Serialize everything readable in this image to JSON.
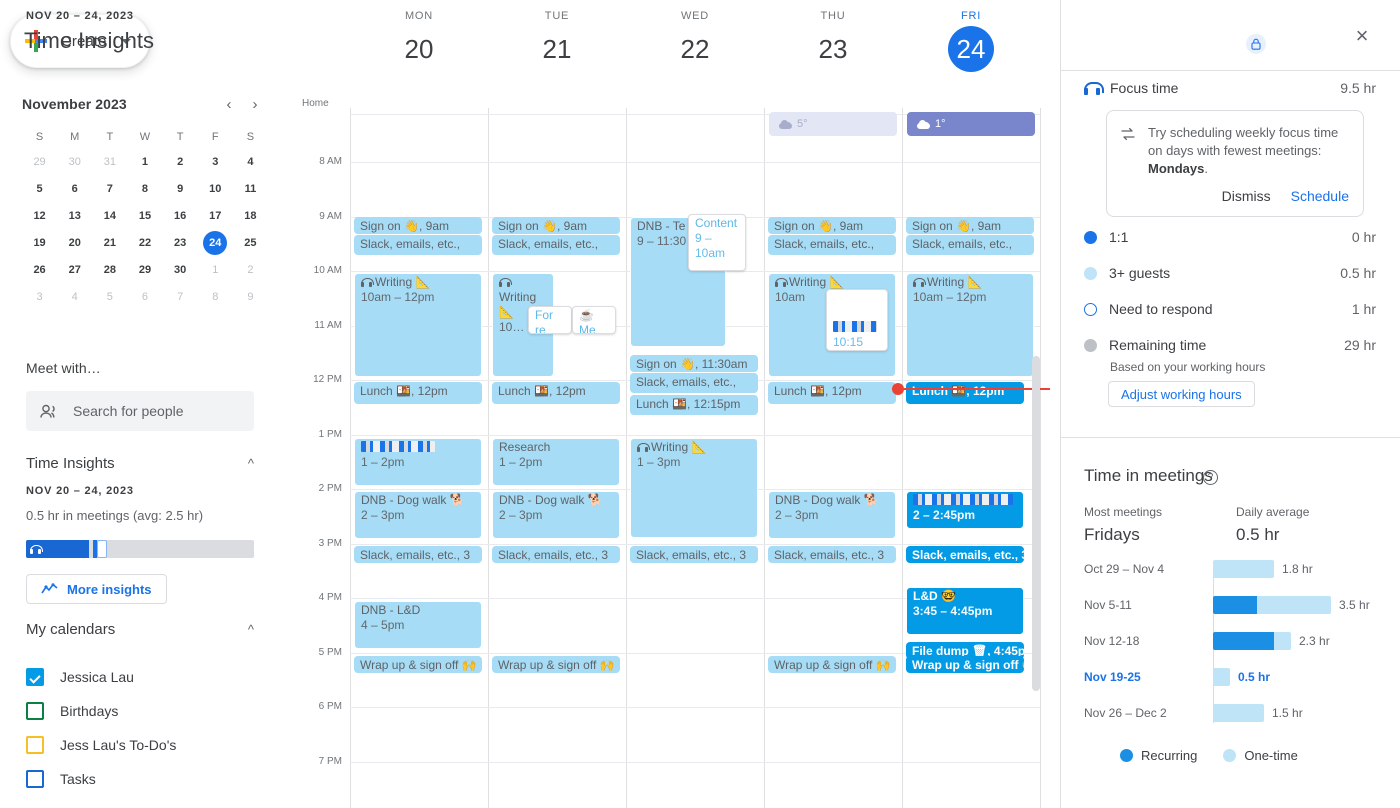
{
  "sidebar": {
    "create": {
      "label": "Create",
      "icon": "plus-icon",
      "caret": "chevron-down-icon"
    },
    "mini_calendar": {
      "title": "November 2023",
      "prev": "‹",
      "next": "›",
      "weekday_initials": [
        "S",
        "M",
        "T",
        "W",
        "T",
        "F",
        "S"
      ],
      "weeks": [
        [
          {
            "d": "29",
            "dim": true
          },
          {
            "d": "30",
            "dim": true
          },
          {
            "d": "31",
            "dim": true
          },
          {
            "d": "1"
          },
          {
            "d": "2"
          },
          {
            "d": "3"
          },
          {
            "d": "4"
          }
        ],
        [
          {
            "d": "5"
          },
          {
            "d": "6"
          },
          {
            "d": "7"
          },
          {
            "d": "8"
          },
          {
            "d": "9"
          },
          {
            "d": "10"
          },
          {
            "d": "11"
          }
        ],
        [
          {
            "d": "12"
          },
          {
            "d": "13"
          },
          {
            "d": "14"
          },
          {
            "d": "15"
          },
          {
            "d": "16"
          },
          {
            "d": "17"
          },
          {
            "d": "18"
          }
        ],
        [
          {
            "d": "19"
          },
          {
            "d": "20"
          },
          {
            "d": "21"
          },
          {
            "d": "22"
          },
          {
            "d": "23"
          },
          {
            "d": "24",
            "today": true
          },
          {
            "d": "25"
          }
        ],
        [
          {
            "d": "26"
          },
          {
            "d": "27"
          },
          {
            "d": "28"
          },
          {
            "d": "29"
          },
          {
            "d": "30"
          },
          {
            "d": "1",
            "dim": true
          },
          {
            "d": "2",
            "dim": true
          }
        ],
        [
          {
            "d": "3",
            "dim": true
          },
          {
            "d": "4",
            "dim": true
          },
          {
            "d": "5",
            "dim": true
          },
          {
            "d": "6",
            "dim": true
          },
          {
            "d": "7",
            "dim": true
          },
          {
            "d": "8",
            "dim": true
          },
          {
            "d": "9",
            "dim": true
          }
        ]
      ]
    },
    "meet_with": {
      "title": "Meet with…",
      "search_placeholder": "Search for people"
    },
    "time_insights": {
      "title": "Time Insights",
      "range": "NOV 20 – 24, 2023",
      "meetings_line": "0.5 hr in meetings (avg: 2.5 hr)",
      "more_insights_label": "More insights"
    },
    "my_calendars": {
      "title": "My calendars",
      "items": [
        {
          "label": "Jessica Lau",
          "color": "#039be5",
          "checked": true
        },
        {
          "label": "Birthdays",
          "color": "#0b8043",
          "checked": false
        },
        {
          "label": "Jess Lau's To-Do's",
          "color": "#f6bf26",
          "checked": false
        },
        {
          "label": "Tasks",
          "color": "#1967d2",
          "checked": false
        }
      ]
    }
  },
  "calendar": {
    "timezone_label": "Home",
    "days": [
      {
        "dow": "MON",
        "num": "20",
        "today": false
      },
      {
        "dow": "TUE",
        "num": "21",
        "today": false
      },
      {
        "dow": "WED",
        "num": "22",
        "today": false
      },
      {
        "dow": "THU",
        "num": "23",
        "today": false
      },
      {
        "dow": "FRI",
        "num": "24",
        "today": true
      }
    ],
    "hour_labels": [
      "8 AM",
      "9 AM",
      "10 AM",
      "11 AM",
      "12 PM",
      "1 PM",
      "2 PM",
      "3 PM",
      "4 PM",
      "5 PM",
      "6 PM",
      "7 PM"
    ],
    "weather": [
      {
        "day": 3,
        "temp": "5°",
        "style": "muted"
      },
      {
        "day": 4,
        "temp": "1°",
        "style": "solid"
      }
    ],
    "events": {
      "mon": [
        {
          "title": "Sign on 👋, 9am",
          "kind": "chip"
        },
        {
          "title": "Slack, emails, etc.,",
          "kind": "chip"
        },
        {
          "title": "Writing 📐",
          "time": "10am – 12pm",
          "kind": "block",
          "focus": true
        },
        {
          "title": "Lunch 🍱, 12pm",
          "kind": "chip"
        },
        {
          "title": "",
          "time": "1 – 2pm",
          "kind": "block",
          "redacted": true
        },
        {
          "title": "DNB - Dog walk 🐕",
          "time": "2 – 3pm",
          "kind": "block"
        },
        {
          "title": "Slack, emails, etc., 3",
          "kind": "chip"
        },
        {
          "title": "DNB - L&D",
          "time": "4 – 5pm",
          "kind": "block"
        },
        {
          "title": "Wrap up & sign off 🙌",
          "kind": "chip"
        }
      ],
      "tue": [
        {
          "title": "Sign on 👋, 9am",
          "kind": "chip"
        },
        {
          "title": "Slack, emails, etc.,",
          "kind": "chip"
        },
        {
          "title": "Writing 📐",
          "time": "10…",
          "kind": "block",
          "focus": true
        },
        {
          "title": "For re",
          "kind": "overlay"
        },
        {
          "title": "☕ Me",
          "kind": "overlay"
        },
        {
          "title": "Lunch 🍱, 12pm",
          "kind": "chip"
        },
        {
          "title": "Research",
          "time": "1 – 2pm",
          "kind": "block"
        },
        {
          "title": "DNB - Dog walk 🐕",
          "time": "2 – 3pm",
          "kind": "block"
        },
        {
          "title": "Slack, emails, etc., 3",
          "kind": "chip"
        },
        {
          "title": "Wrap up & sign off 🙌",
          "kind": "chip"
        }
      ],
      "wed": [
        {
          "title": "DNB - Te 📷",
          "time": "9 – 11:30",
          "kind": "block"
        },
        {
          "title": "Content",
          "time": "9 – 10am",
          "kind": "overlay"
        },
        {
          "title": "Sign on 👋, 11:30am",
          "kind": "chip"
        },
        {
          "title": "Slack, emails, etc.,",
          "kind": "chip"
        },
        {
          "title": "Lunch 🍱, 12:15pm",
          "kind": "chip"
        },
        {
          "title": "Writing 📐",
          "time": "1 – 3pm",
          "kind": "block",
          "focus": true
        },
        {
          "title": "Slack, emails, etc., 3",
          "kind": "chip"
        }
      ],
      "thu": [
        {
          "title": "Sign on 👋, 9am",
          "kind": "chip"
        },
        {
          "title": "Slack, emails, etc.,",
          "kind": "chip"
        },
        {
          "title": "Writing 📐",
          "time": "10am",
          "kind": "block",
          "focus": true
        },
        {
          "title": "",
          "time": "10:15",
          "kind": "overlay",
          "redacted": true
        },
        {
          "title": "Lunch 🍱, 12pm",
          "kind": "chip"
        },
        {
          "title": "DNB - Dog walk 🐕",
          "time": "2 – 3pm",
          "kind": "block"
        },
        {
          "title": "Slack, emails, etc., 3",
          "kind": "chip"
        },
        {
          "title": "Wrap up & sign off 🙌",
          "kind": "chip"
        }
      ],
      "fri": [
        {
          "title": "Sign on 👋, 9am",
          "kind": "chip"
        },
        {
          "title": "Slack, emails, etc.,",
          "kind": "chip"
        },
        {
          "title": "Writing 📐",
          "time": "10am – 12pm",
          "kind": "block",
          "focus": true
        },
        {
          "title": "Lunch 🍱, 12pm",
          "kind": "chip",
          "dark": true
        },
        {
          "title": "",
          "time": "2 – 2:45pm",
          "kind": "block",
          "dark": true,
          "redacted": true
        },
        {
          "title": "Slack, emails, etc., 3",
          "kind": "chip",
          "dark": true
        },
        {
          "title": "L&D 🤓",
          "time": "3:45 – 4:45pm",
          "kind": "block",
          "dark": true
        },
        {
          "title": "File dump 🗑, 4:45pm",
          "kind": "chip",
          "dark": true
        },
        {
          "title": "Wrap up & sign off 🙌",
          "kind": "chip",
          "dark": true
        }
      ]
    }
  },
  "panel": {
    "range": "NOV 20 – 24, 2023",
    "title": "Time Insights",
    "lock_icon": "lock-icon",
    "close_icon": "close-icon",
    "focus_time": {
      "label": "Focus time",
      "value": "9.5 hr",
      "icon": "headphones-icon"
    },
    "suggestion": {
      "icon": "repeat-icon",
      "text_prefix": "Try scheduling weekly focus time on days with fewest meetings: ",
      "text_bold": "Mondays",
      "text_suffix": ".",
      "dismiss": "Dismiss",
      "schedule": "Schedule"
    },
    "breakdown": [
      {
        "label": "1:1",
        "value": "0 hr",
        "dot": "#1a73e8",
        "style": "filled"
      },
      {
        "label": "3+ guests",
        "value": "0.5 hr",
        "dot": "#bfe3f7",
        "style": "filled"
      },
      {
        "label": "Need to respond",
        "value": "1 hr",
        "dot": "#1a73e8",
        "style": "hollow"
      },
      {
        "label": "Remaining time",
        "value": "29 hr",
        "dot": "#bdc1c6",
        "style": "filled"
      }
    ],
    "working_hours_note": "Based on your working hours",
    "adjust_button": "Adjust working hours",
    "time_in_meetings": {
      "title": "Time in meetings",
      "help_icon": "help-icon",
      "stats": [
        {
          "key": "Most meetings",
          "value": "Fridays"
        },
        {
          "key": "Daily average",
          "value": "0.5 hr"
        }
      ]
    }
  },
  "chart_data": {
    "type": "bar",
    "title": "Time in meetings",
    "orientation": "horizontal",
    "stacked": true,
    "categories": [
      "Oct 29 – Nov 4",
      "Nov 5-11",
      "Nov 12-18",
      "Nov 19-25",
      "Nov 26 – Dec 2"
    ],
    "series": [
      {
        "name": "Recurring",
        "color": "#1a8fe3",
        "values": [
          0,
          1.3,
          1.8,
          0,
          0
        ]
      },
      {
        "name": "One-time",
        "color": "#bfe3f7",
        "values": [
          1.8,
          2.2,
          0.5,
          0.5,
          1.5
        ]
      }
    ],
    "totals": [
      1.8,
      3.5,
      2.3,
      0.5,
      1.5
    ],
    "value_labels": [
      "1.8 hr",
      "3.5 hr",
      "2.3 hr",
      "0.5 hr",
      "1.5 hr"
    ],
    "selected_category": "Nov 19-25",
    "xlabel": "",
    "ylabel": "",
    "unit": "hr",
    "legend": [
      "Recurring",
      "One-time"
    ],
    "legend_position": "bottom",
    "grid": false
  }
}
